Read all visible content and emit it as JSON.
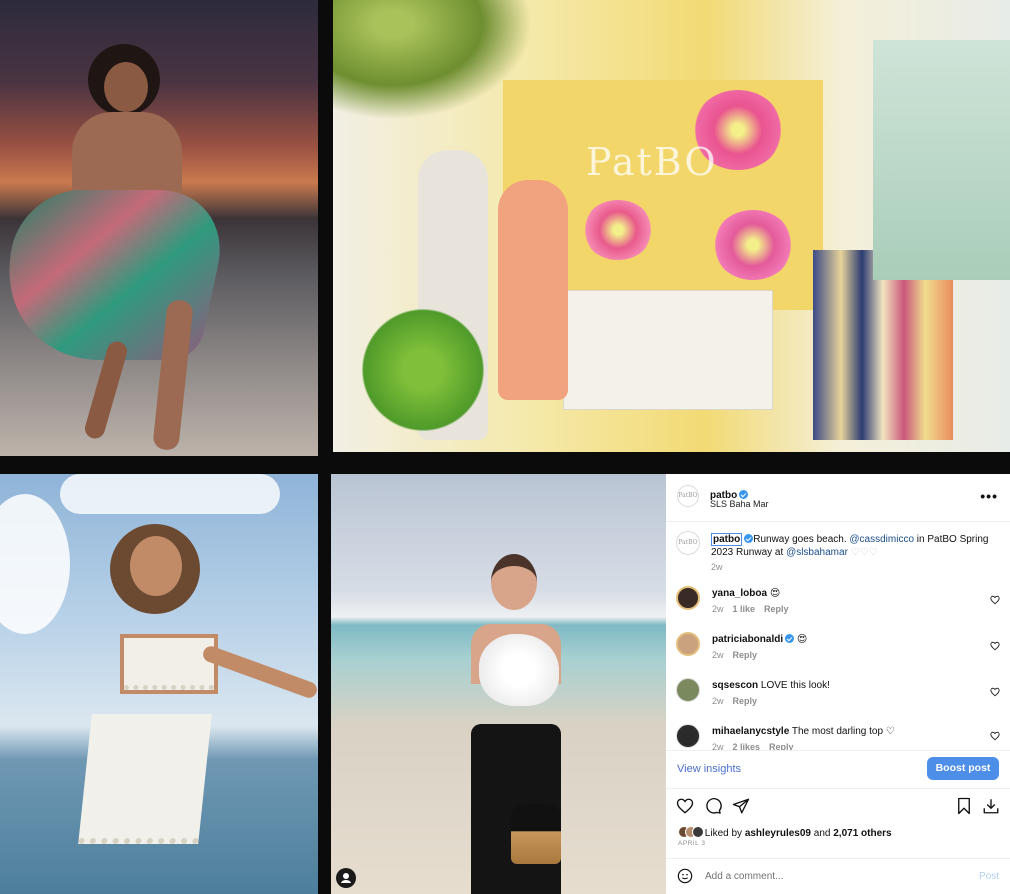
{
  "post": {
    "username": "patbo",
    "location": "SLS Baha Mar",
    "avatar_text": "PatBO",
    "caption_username": "patbo",
    "caption_text_1": "Runway goes beach. ",
    "caption_mention_1": "@cassdimicco",
    "caption_text_2": " in PatBO Spring",
    "caption_text_3": "2023 Runway at ",
    "caption_mention_2": "@slsbahamar",
    "caption_hearts": " ♡♡♡",
    "caption_age": "2w"
  },
  "comments": [
    {
      "user": "yana_loboa",
      "text": "😍",
      "age": "2w",
      "likes": "1 like",
      "reply": "Reply",
      "avatar_color": "#3a2a25"
    },
    {
      "user": "patriciabonaldi",
      "text": "😍",
      "age": "2w",
      "likes": "",
      "reply": "Reply",
      "avatar_color": "#c9a27e",
      "verified": true
    },
    {
      "user": "sqsescon",
      "text": "LOVE this look!",
      "age": "2w",
      "likes": "",
      "reply": "Reply",
      "avatar_color": "#7b8a5e"
    },
    {
      "user": "mihaelanycstyle",
      "text": "The most darling top ♡",
      "age": "2w",
      "likes": "2 likes",
      "reply": "Reply",
      "avatar_color": "#2b2b2b"
    }
  ],
  "actions": {
    "view_insights": "View insights",
    "boost_post": "Boost post",
    "more": "•••"
  },
  "likes": {
    "prefix": "Liked by ",
    "user": "ashleyrules09",
    "middle": " and ",
    "count": "2,071 others"
  },
  "date": "APRIL 3",
  "composer": {
    "placeholder": "Add a comment...",
    "post_label": "Post"
  },
  "images": {
    "boutique_logo": "PatBO"
  },
  "colors": {
    "accent_blue": "#4c8ee8",
    "link_blue": "#1d4e89",
    "muted": "#8e8e8e"
  },
  "icons": [
    "heart-icon",
    "comment-icon",
    "share-icon",
    "bookmark-icon",
    "download-icon",
    "emoji-icon",
    "more-icon",
    "user-icon"
  ]
}
